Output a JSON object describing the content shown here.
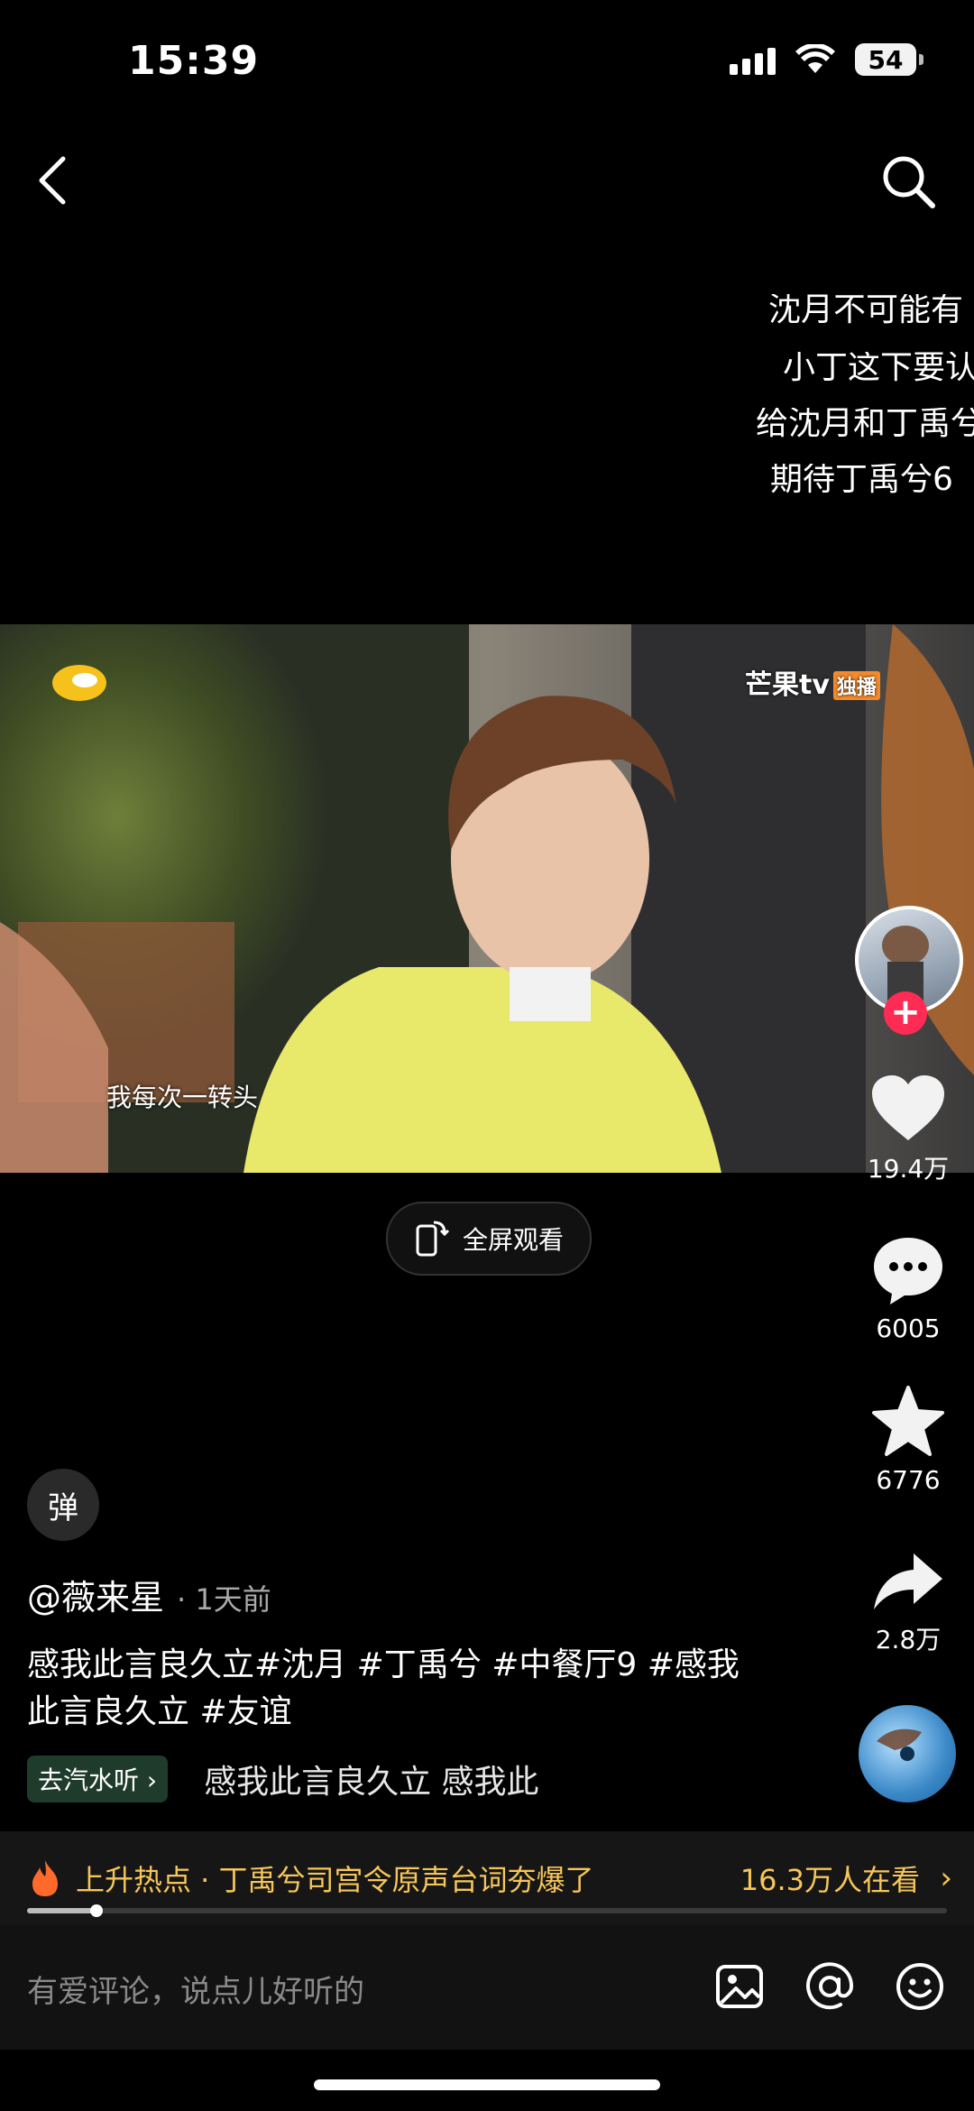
{
  "status_bar": {
    "time": "15:39",
    "battery": "54"
  },
  "danmaku": [
    "沈月不可能有",
    "小丁这下要认",
    "给沈月和丁禹兮",
    "期待丁禹兮6"
  ],
  "video": {
    "subtitle": "我每次一转头",
    "watermark_brand": "芒果tv",
    "watermark_badge": "独播"
  },
  "fullscreen_label": "全屏观看",
  "actions": {
    "likes": "19.4万",
    "comments": "6005",
    "favorites": "6776",
    "shares": "2.8万"
  },
  "danmu_toggle": "弹",
  "author": {
    "name": "@薇来星",
    "time": "· 1天前"
  },
  "caption": "感我此言良久立#沈月 #丁禹兮 #中餐厅9 #感我此言良久立 #友谊",
  "tag_pill": "去汽水听 ›",
  "music_marquee": "感我此言良久立    感我此",
  "hot": {
    "text": "上升热点 · 丁禹兮司宫令原声台词夯爆了",
    "viewers": "16.3万人在看",
    "chevron": "›"
  },
  "progress": 0.075,
  "comment": {
    "placeholder": "有爱评论，说点儿好听的"
  }
}
